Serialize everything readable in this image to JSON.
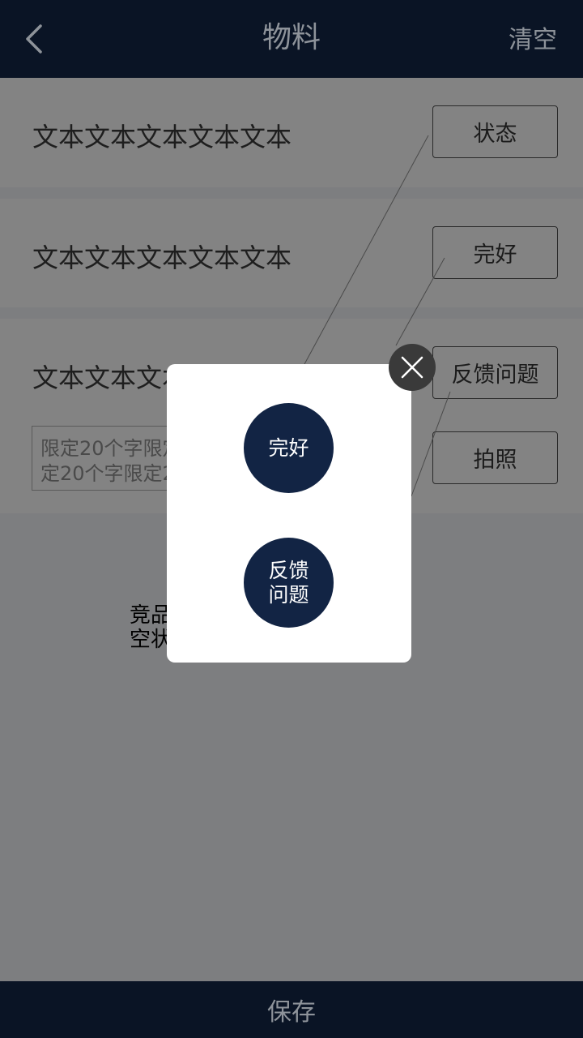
{
  "header": {
    "title": "物料",
    "clear_label": "清空",
    "back_icon": "chevron-left-icon"
  },
  "rows": [
    {
      "text": "文本文本文本文本文本",
      "button": "状态"
    },
    {
      "text": "文本文本文本文本文本",
      "button": "完好"
    },
    {
      "text": "文本文本文本文本文本",
      "button": "反馈问题",
      "button2": "拍照"
    }
  ],
  "textarea": {
    "text": "限定20个字限定20个字\n定20个字限定20个字"
  },
  "competitor_text": "竞品\n空状",
  "footer": {
    "save_label": "保存"
  },
  "modal": {
    "option_ok": "完好",
    "option_feedback": "反馈\n问题",
    "close_icon": "close-icon"
  },
  "colors": {
    "navbar": "#0a1425",
    "overlay_bg": "#7d7e80",
    "modal_button": "#122444",
    "close_button": "#3a3a3a"
  }
}
